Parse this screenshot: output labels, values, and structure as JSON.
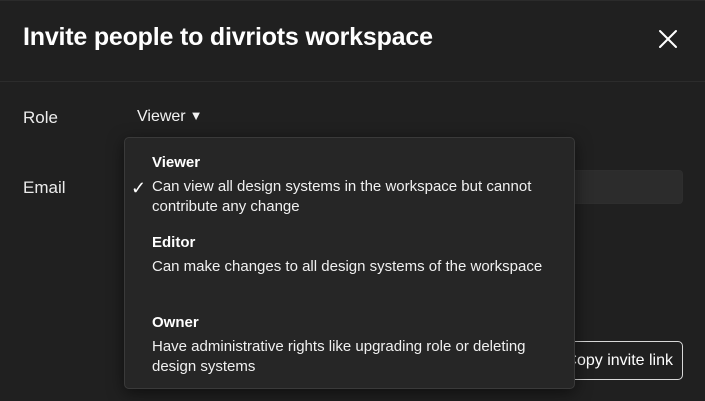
{
  "dialog": {
    "title": "Invite people to divriots workspace",
    "close_icon": "close-icon"
  },
  "form": {
    "role_label": "Role",
    "role_value": "Viewer",
    "role_caret": "▼",
    "email_label": "Email",
    "email_value": "",
    "copy_link_label": "Copy invite link"
  },
  "role_dropdown": {
    "selected": "Viewer",
    "check_glyph": "✓",
    "options": [
      {
        "title": "Viewer",
        "description": "Can view all design systems in the workspace but cannot contribute any change"
      },
      {
        "title": "Editor",
        "description": "Can make changes to all design systems of the workspace"
      },
      {
        "title": "Owner",
        "description": "Have administrative rights like upgrading role or deleting design systems"
      }
    ]
  },
  "colors": {
    "background": "#202020",
    "dropdown_background": "#262626",
    "text": "#ffffff"
  }
}
